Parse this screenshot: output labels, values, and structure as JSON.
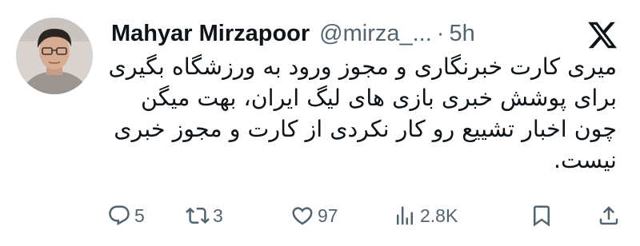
{
  "author": {
    "display_name": "Mahyar Mirzapoor",
    "handle": "@mirza_...",
    "separator": "·",
    "time": "5h"
  },
  "tweet": {
    "lines": [
      "میری کارت خبرنگاری و مجوز ورود به ورزشگاه بگیری",
      "برای پوشش خبری بازی های لیگ ایران، بهت میگن",
      "چون اخبار تشییع رو کار نکردی از کارت و مجوز خبری",
      "نیست."
    ]
  },
  "actions": {
    "reply": {
      "icon": "reply-icon",
      "count": "5"
    },
    "retweet": {
      "icon": "retweet-icon",
      "count": "3"
    },
    "like": {
      "icon": "heart-icon",
      "count": "97"
    },
    "views": {
      "icon": "views-icon",
      "count": "2.8K"
    },
    "bookmark": {
      "icon": "bookmark-icon"
    },
    "share": {
      "icon": "share-icon"
    }
  },
  "brand": {
    "icon": "x-logo-icon"
  },
  "colors": {
    "text": "#0f1419",
    "muted": "#536471",
    "background": "#ffffff"
  }
}
